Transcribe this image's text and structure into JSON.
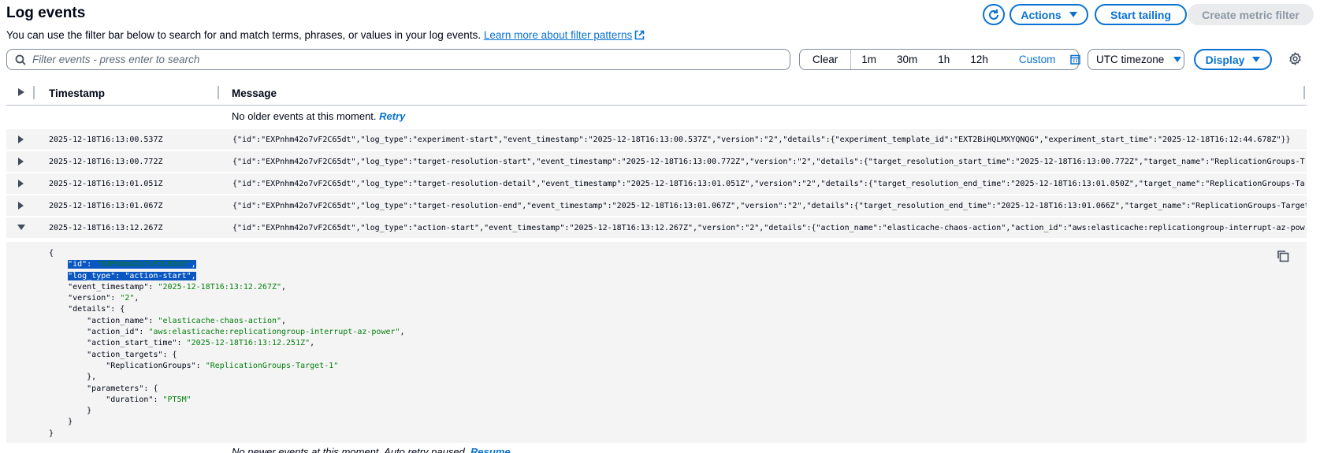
{
  "header": {
    "title": "Log events",
    "subtitle": "You can use the filter bar below to search for and match terms, phrases, or values in your log events.",
    "learn_more": "Learn more about filter patterns",
    "actions_label": "Actions",
    "start_tailing_label": "Start tailing",
    "create_metric_filter_label": "Create metric filter"
  },
  "filter": {
    "placeholder": "Filter events - press enter to search",
    "value": ""
  },
  "time_range": {
    "clear": "Clear",
    "options": [
      "1m",
      "30m",
      "1h",
      "12h"
    ],
    "custom": "Custom",
    "timezone": "UTC timezone",
    "display": "Display"
  },
  "table": {
    "col_timestamp": "Timestamp",
    "col_message": "Message",
    "no_older_text": "No older events at this moment.",
    "retry": "Retry",
    "no_newer_text": "No newer events at this moment.",
    "auto_retry": "Auto retry paused.",
    "resume": "Resume",
    "rows": [
      {
        "timestamp": "2025-12-18T16:13:00.537Z",
        "message": "{\"id\":\"EXPnhm42o7vF2C65dt\",\"log_type\":\"experiment-start\",\"event_timestamp\":\"2025-12-18T16:13:00.537Z\",\"version\":\"2\",\"details\":{\"experiment_template_id\":\"EXT2BiHQLMXYQNQG\",\"experiment_start_time\":\"2025-12-18T16:12:44.678Z\"}}"
      },
      {
        "timestamp": "2025-12-18T16:13:00.772Z",
        "message": "{\"id\":\"EXPnhm42o7vF2C65dt\",\"log_type\":\"target-resolution-start\",\"event_timestamp\":\"2025-12-18T16:13:00.772Z\",\"version\":\"2\",\"details\":{\"target_resolution_start_time\":\"2025-12-18T16:13:00.772Z\",\"target_name\":\"ReplicationGroups-T"
      },
      {
        "timestamp": "2025-12-18T16:13:01.051Z",
        "message": "{\"id\":\"EXPnhm42o7vF2C65dt\",\"log_type\":\"target-resolution-detail\",\"event_timestamp\":\"2025-12-18T16:13:01.051Z\",\"version\":\"2\",\"details\":{\"target_resolution_end_time\":\"2025-12-18T16:13:01.050Z\",\"target_name\":\"ReplicationGroups-Ta"
      },
      {
        "timestamp": "2025-12-18T16:13:01.067Z",
        "message": "{\"id\":\"EXPnhm42o7vF2C65dt\",\"log_type\":\"target-resolution-end\",\"event_timestamp\":\"2025-12-18T16:13:01.067Z\",\"version\":\"2\",\"details\":{\"target_resolution_end_time\":\"2025-12-18T16:13:01.066Z\",\"target_name\":\"ReplicationGroups-Target"
      },
      {
        "timestamp": "2025-12-18T16:13:12.267Z",
        "message": "{\"id\":\"EXPnhm42o7vF2C65dt\",\"log_type\":\"action-start\",\"event_timestamp\":\"2025-12-18T16:13:12.267Z\",\"version\":\"2\",\"details\":{\"action_name\":\"elasticache-chaos-action\",\"action_id\":\"aws:elasticache:replicationgroup-interrupt-az-pow"
      }
    ]
  },
  "detail": {
    "id": "\"EXPnhm42o7vF2C65dt\"",
    "log_type": "\"action-start\"",
    "event_timestamp": "\"2025-12-18T16:13:12.267Z\"",
    "version": "\"2\"",
    "action_name": "\"elasticache-chaos-action\"",
    "action_id": "\"aws:elasticache:replicationgroup-interrupt-az-power\"",
    "action_start_time": "\"2025-12-18T16:13:12.251Z\"",
    "replication_groups": "\"ReplicationGroups-Target-1\"",
    "duration": "\"PT5M\""
  },
  "colors": {
    "accent": "#0972d3",
    "json_string": "#037f0c",
    "highlight": "#0a57c2"
  }
}
